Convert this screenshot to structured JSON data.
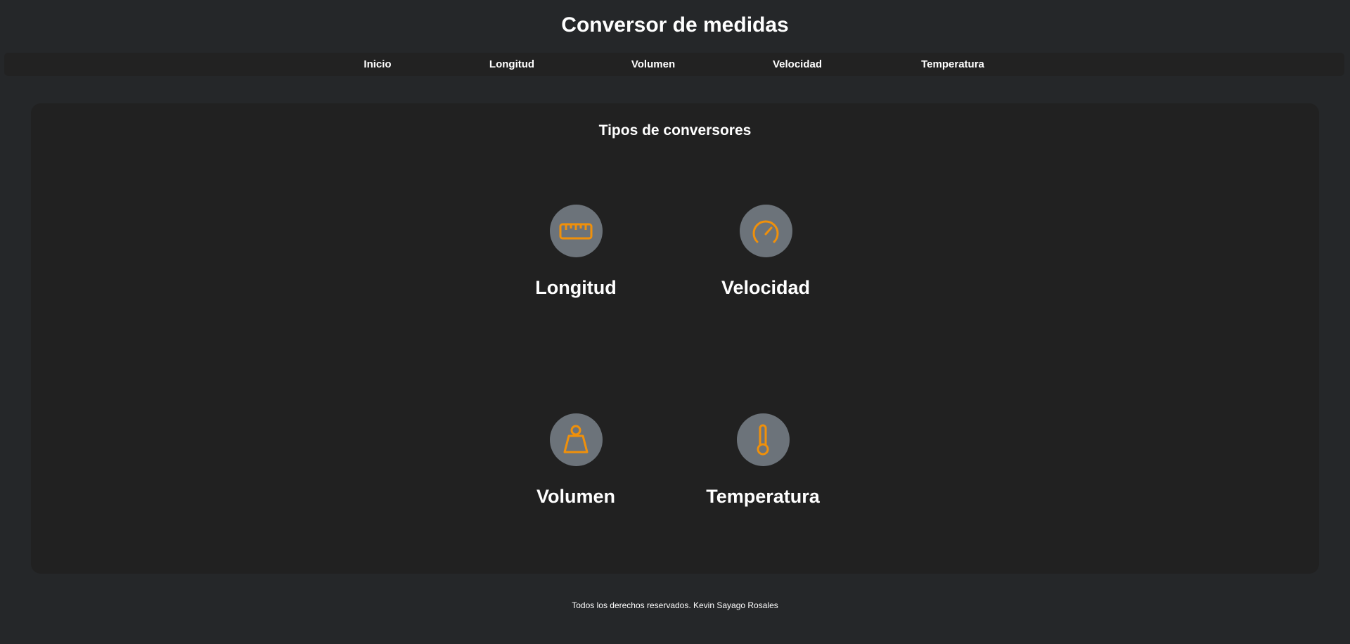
{
  "header": {
    "title": "Conversor de medidas"
  },
  "nav": {
    "items": [
      {
        "label": "Inicio"
      },
      {
        "label": "Longitud"
      },
      {
        "label": "Volumen"
      },
      {
        "label": "Velocidad"
      },
      {
        "label": "Temperatura"
      }
    ]
  },
  "main": {
    "title": "Tipos de conversores",
    "cards": [
      {
        "label": "Longitud",
        "icon": "ruler-icon"
      },
      {
        "label": "Velocidad",
        "icon": "speedometer-icon"
      },
      {
        "label": "Volumen",
        "icon": "weight-icon"
      },
      {
        "label": "Temperatura",
        "icon": "thermometer-icon"
      }
    ]
  },
  "footer": {
    "text": "Todos los derechos reservados. Kevin Sayago Rosales"
  },
  "colors": {
    "background": "#252729",
    "panel": "#212121",
    "icon_circle": "#6c737a",
    "icon_accent": "#f0900a"
  }
}
